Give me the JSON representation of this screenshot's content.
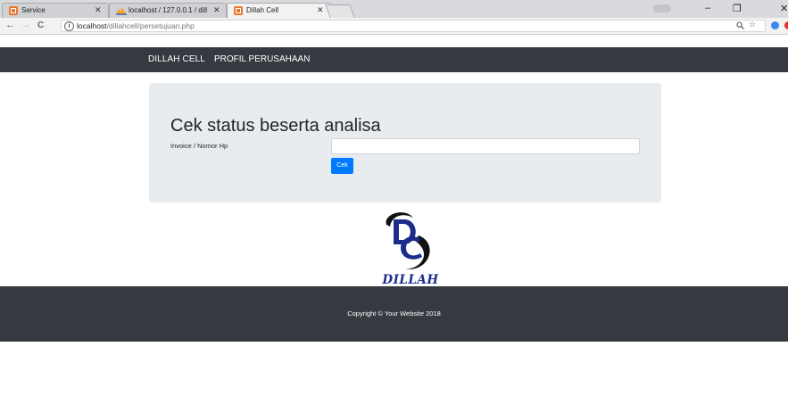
{
  "browser": {
    "tabs": [
      {
        "title": "Service",
        "active": false
      },
      {
        "title": "localhost / 127.0.0.1 / dill",
        "active": false
      },
      {
        "title": "Dillah Cell",
        "active": true
      }
    ],
    "url_host": "localhost",
    "url_path": "/dillahcell/persetujuan.php",
    "window_controls": {
      "minimize": "–",
      "maximize": "❐",
      "close": "✕"
    },
    "nav_icons": {
      "back": "←",
      "forward": "→",
      "reload": "C"
    }
  },
  "site": {
    "brand": "DILLAH CELL",
    "nav_link": "PROFIL PERUSAHAAN",
    "form": {
      "title": "Cek status beserta analisa",
      "label": "Invoice / Nomor Hp",
      "input_value": "",
      "button": "Cek"
    },
    "logo_text": "DILLAH CELL",
    "footer_text": "Copyright © Your Website 2018"
  },
  "colors": {
    "navbar": "#343a40",
    "jumbotron": "#e9ecef",
    "primary": "#007bff",
    "logo_blue": "#1c2c8c"
  },
  "icons": [
    "info-icon",
    "zoom-icon",
    "star-icon",
    "close-icon",
    "tab-favicon-icon",
    "phpmyadmin-favicon-icon"
  ]
}
